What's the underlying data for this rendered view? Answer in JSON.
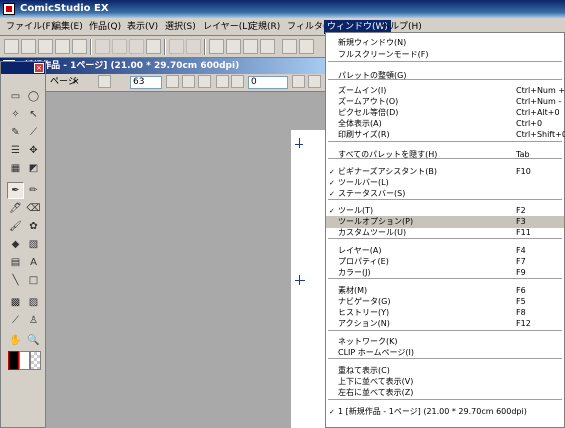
{
  "app": {
    "title": "ComicStudio EX"
  },
  "menubar": {
    "items": [
      {
        "label": "ファイル(F)"
      },
      {
        "label": "編集(E)"
      },
      {
        "label": "作品(Q)"
      },
      {
        "label": "表示(V)"
      },
      {
        "label": "選択(S)"
      },
      {
        "label": "レイヤー(L)"
      },
      {
        "label": "定規(R)"
      },
      {
        "label": "フィルタ(I)"
      },
      {
        "label": "ウィンドウ(W)"
      },
      {
        "label": "ヘルプ(H)"
      }
    ]
  },
  "document": {
    "title": "[新規作品 - 1ページ] (21.00 * 29.70cm 600dpi)"
  },
  "options": {
    "tab_label": "ページ",
    "close_glyph": "×",
    "size_value": "63",
    "angle_value": "0"
  },
  "window_menu": {
    "items": [
      {
        "label": "新規ウィンドウ(N)",
        "shortcut": ""
      },
      {
        "label": "フルスクリーンモード(F)",
        "shortcut": ""
      },
      {
        "label": "パレットの整頓(G)",
        "shortcut": ""
      },
      {
        "label": "ズームイン(I)",
        "shortcut": "Ctrl+Num +"
      },
      {
        "label": "ズームアウト(O)",
        "shortcut": "Ctrl+Num -"
      },
      {
        "label": "ピクセル等倍(D)",
        "shortcut": "Ctrl+Alt+0"
      },
      {
        "label": "全体表示(A)",
        "shortcut": "Ctrl+0"
      },
      {
        "label": "印刷サイズ(R)",
        "shortcut": "Ctrl+Shift+0"
      },
      {
        "label": "すべてのパレットを隠す(H)",
        "shortcut": "Tab"
      },
      {
        "label": "ビギナーズアシスタント(B)",
        "shortcut": "F10",
        "checked": true
      },
      {
        "label": "ツールバー(L)",
        "shortcut": "",
        "checked": true
      },
      {
        "label": "ステータスバー(S)",
        "shortcut": "",
        "checked": true
      },
      {
        "label": "ツール(T)",
        "shortcut": "F2",
        "checked": true
      },
      {
        "label": "ツールオプション(P)",
        "shortcut": "F3",
        "highlighted": true
      },
      {
        "label": "カスタムツール(U)",
        "shortcut": "F11"
      },
      {
        "label": "レイヤー(A)",
        "shortcut": "F4"
      },
      {
        "label": "プロパティ(E)",
        "shortcut": "F7"
      },
      {
        "label": "カラー(J)",
        "shortcut": "F9"
      },
      {
        "label": "素材(M)",
        "shortcut": "F6"
      },
      {
        "label": "ナビゲータ(G)",
        "shortcut": "F5"
      },
      {
        "label": "ヒストリー(Y)",
        "shortcut": "F8"
      },
      {
        "label": "アクション(N)",
        "shortcut": "F12"
      },
      {
        "label": "ネットワーク(K)",
        "shortcut": ""
      },
      {
        "label": "CLIP ホームページ(I)",
        "shortcut": ""
      },
      {
        "label": "重ねて表示(C)",
        "shortcut": ""
      },
      {
        "label": "上下に並べて表示(V)",
        "shortcut": ""
      },
      {
        "label": "左右に並べて表示(Z)",
        "shortcut": ""
      },
      {
        "label": "1 [新規作品 - 1ページ] (21.00 * 29.70cm 600dpi)",
        "shortcut": "",
        "checked": true
      }
    ]
  },
  "colors": {
    "titlebar": "#0a246a",
    "menu_highlight": "#c8c4bc",
    "chrome": "#d4d0c8",
    "canvas": "#a9a9a9"
  },
  "icons": {
    "check": "✓",
    "text_tool": "A"
  }
}
